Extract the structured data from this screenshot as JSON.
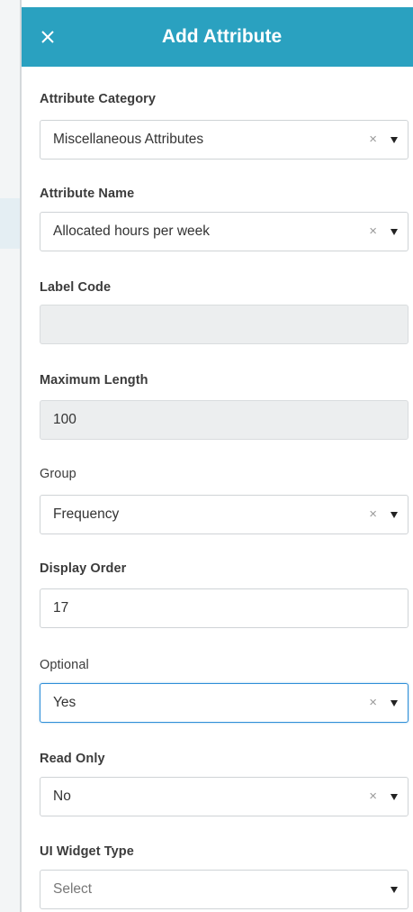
{
  "header": {
    "title": "Add Attribute",
    "close_icon": "close-icon",
    "background_color": "#2aa1c0"
  },
  "fields": {
    "attribute_category": {
      "label": "Attribute Category",
      "value": "Miscellaneous Attributes",
      "clear": "×"
    },
    "attribute_name": {
      "label": "Attribute Name",
      "value": "Allocated hours per week",
      "clear": "×"
    },
    "label_code": {
      "label": "Label Code",
      "value": ""
    },
    "maximum_length": {
      "label": "Maximum Length",
      "value": "100"
    },
    "group": {
      "label": "Group",
      "value": "Frequency",
      "clear": "×"
    },
    "display_order": {
      "label": "Display Order",
      "value": "17"
    },
    "optional": {
      "label": "Optional",
      "value": "Yes",
      "clear": "×"
    },
    "read_only": {
      "label": "Read Only",
      "value": "No",
      "clear": "×"
    },
    "ui_widget_type": {
      "label": "UI Widget Type",
      "placeholder": "Select"
    }
  },
  "colors": {
    "focus_border": "#2f8fd8",
    "disabled_background": "#eceeef"
  }
}
